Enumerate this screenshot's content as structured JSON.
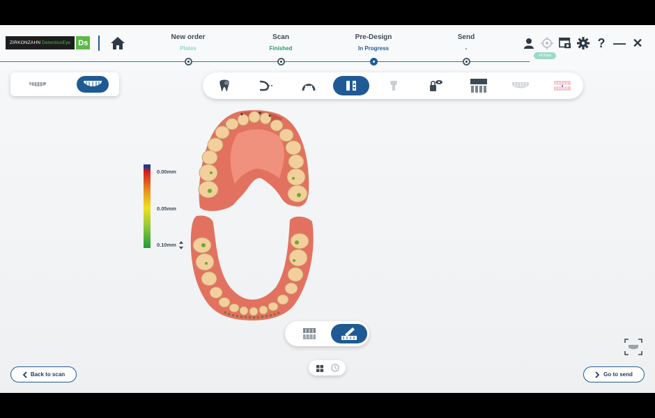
{
  "brand": {
    "name": "ZIRKONZAHN",
    "product": "DetectionEye",
    "logo_letter": "Ds"
  },
  "steps": [
    {
      "title": "New order",
      "status": "Plates",
      "status_color": "#8fd8c4"
    },
    {
      "title": "Scan",
      "status": "Finished",
      "status_color": "#1f9b6a"
    },
    {
      "title": "Pre-Design",
      "status": "In Progress",
      "status_color": "#1f5a94"
    },
    {
      "title": "Send",
      "status": "-",
      "status_color": "#3d4a55"
    }
  ],
  "header_icons": [
    "user-icon",
    "crosshair-icon",
    "window-camera-icon",
    "gear-icon",
    "help-icon",
    "minimize-icon",
    "close-icon"
  ],
  "header_symbols": {
    "help": "?",
    "minimize": "—",
    "close": "✕"
  },
  "badge_text": "+8 Parts",
  "jaw_toggle": [
    "lower-jaw-icon",
    "upper-jaw-icon"
  ],
  "toolbar": [
    "tooth-icon",
    "curve-icon",
    "arch-icon",
    "split-arrows-icon",
    "implant-icon",
    "lock-eye-icon",
    "teeth-set-icon",
    "gingiva-icon",
    "bite-icon"
  ],
  "colorbar": {
    "labels": [
      "0.00mm",
      "0.05mm",
      "0.10mm"
    ]
  },
  "bottom": {
    "back_label": "Back to scan",
    "next_label": "Go to send"
  },
  "colors": {
    "accent": "#1f5a94",
    "teal": "#1a8a8a"
  }
}
